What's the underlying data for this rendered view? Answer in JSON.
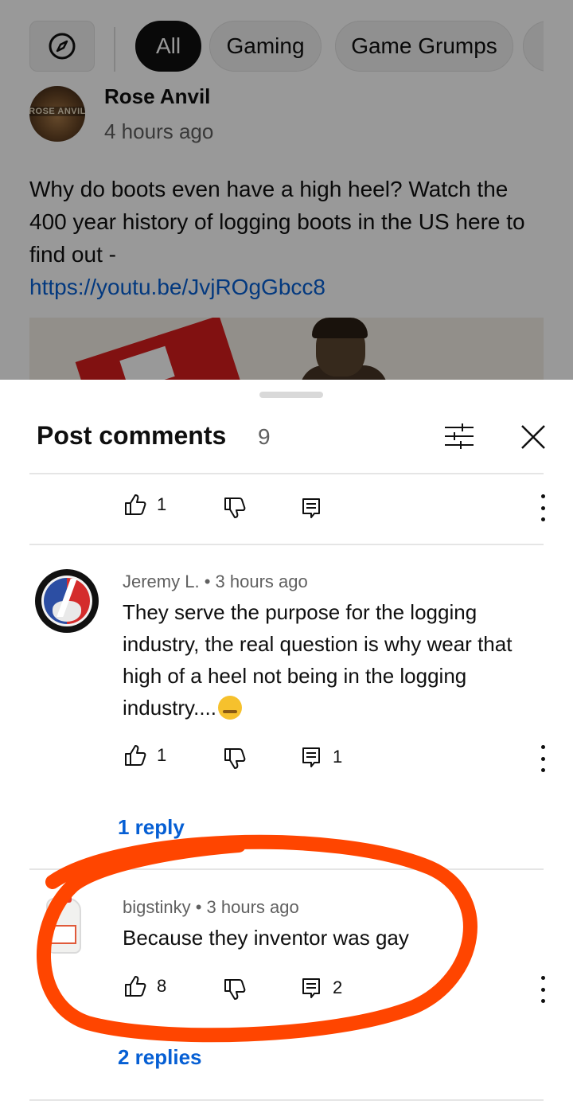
{
  "filters": {
    "chips": [
      "All",
      "Gaming",
      "Game Grumps"
    ],
    "active_chip": "All"
  },
  "post": {
    "channel": "Rose Anvil",
    "avatar_text": "ROSE ANVIL",
    "time": "4 hours ago",
    "text": "Why do boots even have a high heel? Watch the 400 year history of logging boots in the US here to find out -",
    "link": "https://youtu.be/JvjROgGbcc8"
  },
  "comments_sheet": {
    "title": "Post comments",
    "count": "9"
  },
  "comments": [
    {
      "likes": "1"
    },
    {
      "author": "Jeremy L.",
      "time": "3 hours ago",
      "separator": "•",
      "text": "They serve the purpose for the logging industry, the real question is why wear that high of a heel not being in the logging industry....",
      "likes": "1",
      "reply_count": "1",
      "replies_link": "1 reply"
    },
    {
      "author": "bigstinky",
      "time": "3 hours ago",
      "separator": "•",
      "text": "Because they inventor was gay",
      "likes": "8",
      "reply_count": "2",
      "replies_link": "2 replies"
    }
  ],
  "colors": {
    "link_blue": "#065fd4",
    "annotation_orange": "#ff4500",
    "text_primary": "#0f0f0f",
    "text_secondary": "#606060"
  }
}
